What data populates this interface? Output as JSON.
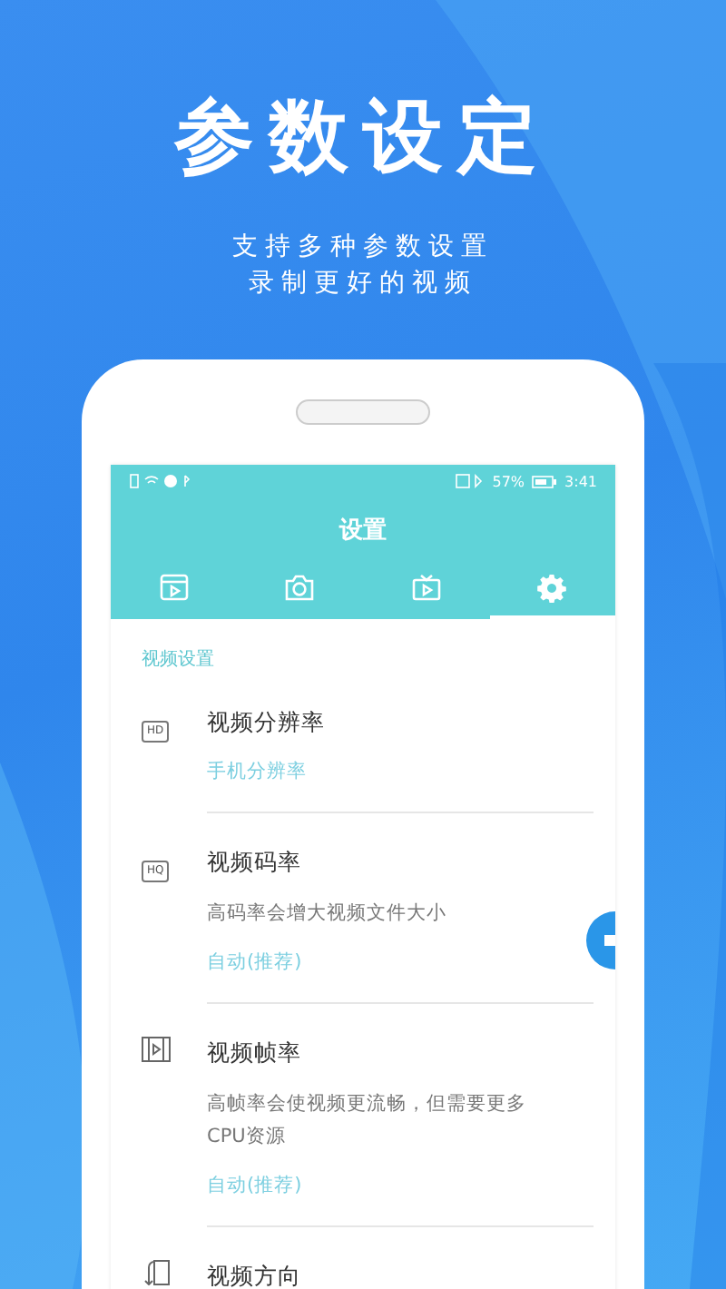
{
  "headline": "参数设定",
  "subtitle": [
    "支持多种参数设置",
    "录制更好的视频"
  ],
  "status_bar": {
    "battery_text": "57%",
    "time": "3:41"
  },
  "app_bar": {
    "title": "设置"
  },
  "tabs": [
    {
      "kind": "film",
      "selected": false
    },
    {
      "kind": "camera",
      "selected": false
    },
    {
      "kind": "tv",
      "selected": false
    },
    {
      "kind": "gear",
      "selected": true
    }
  ],
  "section": "视频设置",
  "settings": [
    {
      "kind": "badge",
      "badge": "HD",
      "title": "视频分辨率",
      "value": "手机分辨率"
    },
    {
      "kind": "badge",
      "badge": "HQ",
      "title": "视频码率",
      "description": "高码率会增大视频文件大小",
      "value": "自动(推荐)"
    },
    {
      "kind": "filmstrip",
      "title": "视频帧率",
      "description": "高帧率会使视频更流畅，但需要更多CPU资源",
      "value": "自动(推荐)"
    },
    {
      "kind": "rotate",
      "title": "视频方向"
    }
  ]
}
